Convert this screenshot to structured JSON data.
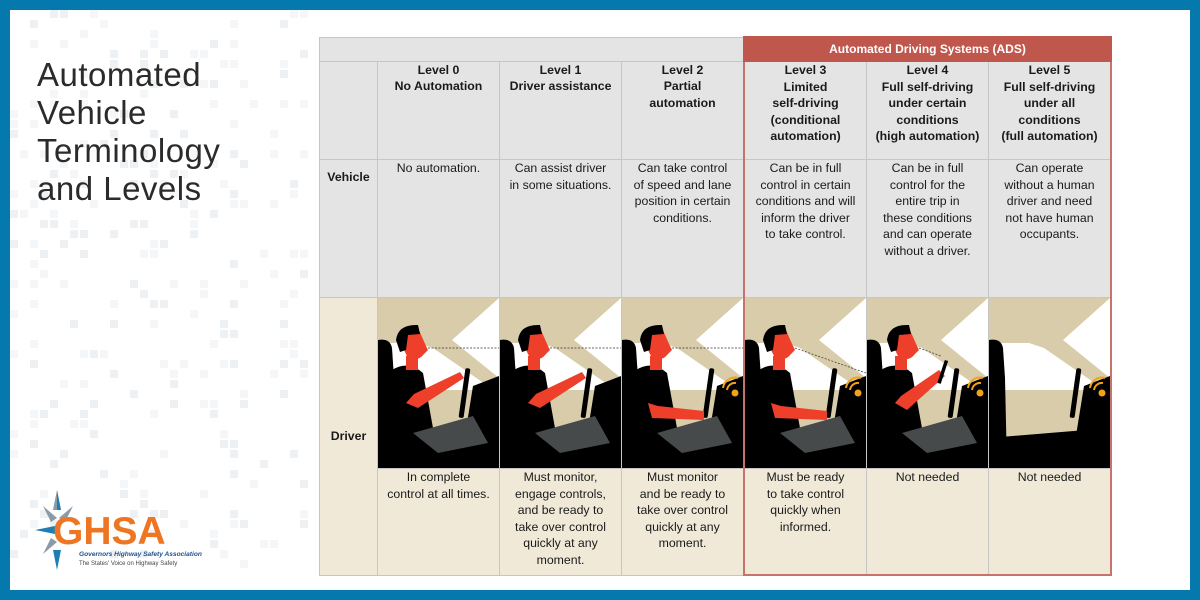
{
  "title": {
    "lines": [
      "Automated",
      "Vehicle",
      "Terminology",
      "and Levels"
    ]
  },
  "logo": {
    "acronym": "GHSA",
    "name": "Governors Highway Safety Association",
    "tagline": "The States' Voice on Highway Safety"
  },
  "colors": {
    "frame_blue": "#0579ad",
    "ads_red": "#c0574d",
    "header_gray": "#e4e4e4",
    "driver_cream": "#f0e9d8",
    "illustration_tan": "#d9ccaa",
    "skin_red": "#ee3f2a",
    "signal_orange": "#f2a31b",
    "logo_orange": "#ee7623"
  },
  "table": {
    "group_header": "Automated Driving Systems (ADS)",
    "row_labels": {
      "vehicle": "Vehicle",
      "driver": "Driver"
    },
    "levels": [
      {
        "heading": [
          "Level 0",
          "No Automation"
        ],
        "vehicle": [
          "No automation."
        ],
        "driver": [
          "In complete",
          "control at all times."
        ],
        "illustration": {
          "driver_present": true,
          "driver_pose": "hands-on-wheel",
          "gaze": "road",
          "automation_signal": false
        }
      },
      {
        "heading": [
          "Level 1",
          "Driver assistance"
        ],
        "vehicle": [
          "Can assist driver",
          "in some situations."
        ],
        "driver": [
          "Must monitor,",
          "engage controls,",
          "and be ready to",
          "take over control",
          "quickly at any",
          "moment."
        ],
        "illustration": {
          "driver_present": true,
          "driver_pose": "hands-on-wheel",
          "gaze": "road",
          "automation_signal": false
        }
      },
      {
        "heading": [
          "Level 2",
          "Partial",
          "automation"
        ],
        "vehicle": [
          "Can take control",
          "of speed and lane",
          "position in certain",
          "conditions."
        ],
        "driver": [
          "Must monitor",
          "and be ready to",
          "take over control",
          "quickly at any",
          "moment."
        ],
        "illustration": {
          "driver_present": true,
          "driver_pose": "hands-low",
          "gaze": "road",
          "automation_signal": true
        }
      },
      {
        "heading": [
          "Level 3",
          "Limited",
          "self-driving",
          "(conditional",
          "automation)"
        ],
        "vehicle": [
          "Can be in full",
          "control in certain",
          "conditions and will",
          "inform the driver",
          "to take control."
        ],
        "driver": [
          "Must be ready",
          "to take control",
          "quickly when",
          "informed."
        ],
        "illustration": {
          "driver_present": true,
          "driver_pose": "hands-low",
          "gaze": "dashboard",
          "automation_signal": true
        }
      },
      {
        "heading": [
          "Level 4",
          "Full self-driving",
          "under certain",
          "conditions",
          "(high automation)"
        ],
        "vehicle": [
          "Can be in full",
          "control for the",
          "entire trip in",
          "these conditions",
          "and can operate",
          "without a driver."
        ],
        "driver": [
          "Not needed"
        ],
        "illustration": {
          "driver_present": true,
          "driver_pose": "holding-phone",
          "gaze": "phone",
          "automation_signal": true
        }
      },
      {
        "heading": [
          "Level 5",
          "Full self-driving",
          "under all",
          "conditions",
          "(full automation)"
        ],
        "vehicle": [
          "Can operate",
          "without a human",
          "driver and need",
          "not have human",
          "occupants."
        ],
        "driver": [
          "Not needed"
        ],
        "illustration": {
          "driver_present": false,
          "driver_pose": "none",
          "gaze": "none",
          "automation_signal": true
        }
      }
    ]
  }
}
